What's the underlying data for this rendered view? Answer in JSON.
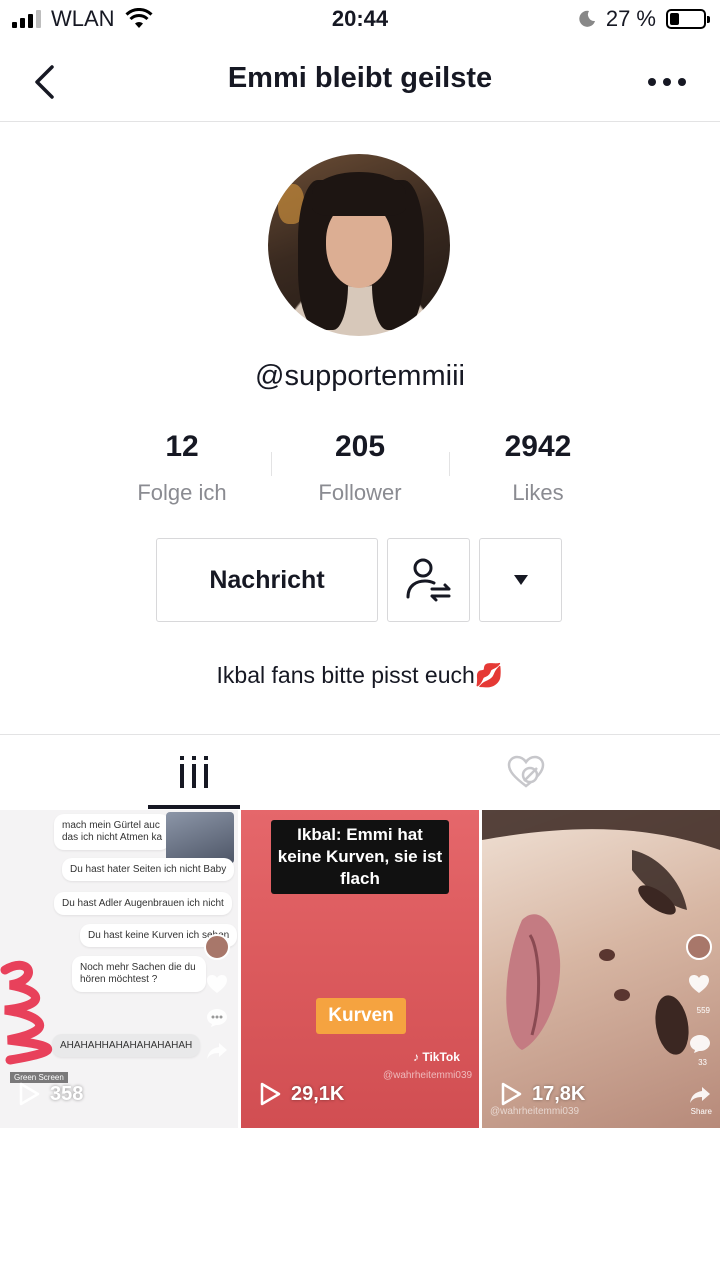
{
  "status_bar": {
    "carrier": "WLAN",
    "time": "20:44",
    "battery_percent": "27 %",
    "battery_level": 0.27
  },
  "nav": {
    "title": "Emmi bleibt geilste",
    "back_icon": "chevron-left-icon",
    "more_icon": "more-horizontal-icon"
  },
  "profile": {
    "username": "@supportemmiii",
    "stats": [
      {
        "value": "12",
        "label": "Folge ich"
      },
      {
        "value": "205",
        "label": "Follower"
      },
      {
        "value": "2942",
        "label": "Likes"
      }
    ],
    "message_button": "Nachricht",
    "bio": "Ikbal fans bitte pisst euch💋"
  },
  "tabs": {
    "videos_icon": "grid-videos-icon",
    "liked_icon": "liked-hidden-icon"
  },
  "videos": [
    {
      "plays": "358",
      "chat_lines": [
        "mach mein Gürtel auc",
        "das ich nicht Atmen ka",
        "Du hast hater Seiten ich nicht Baby",
        "Du hast Adler Augenbrauen ich nicht",
        "Du hast keine Kurven ich sehen",
        "Noch mehr Sachen die du hören möchtest ?",
        "AHAHAHHAHAHAHAHAHAH",
        "Green Screen"
      ]
    },
    {
      "plays": "29,1K",
      "caption": "Ikbal: Emmi hat keine Kurven, sie ist flach",
      "sticker": "Kurven",
      "watermark_brand": "TikTok",
      "watermark_user": "@wahrheitemmi039"
    },
    {
      "plays": "17,8K",
      "watermark_user": "@wahrheitemmi039",
      "like_count": "559",
      "comment_count": "33",
      "share_label": "Share"
    }
  ]
}
